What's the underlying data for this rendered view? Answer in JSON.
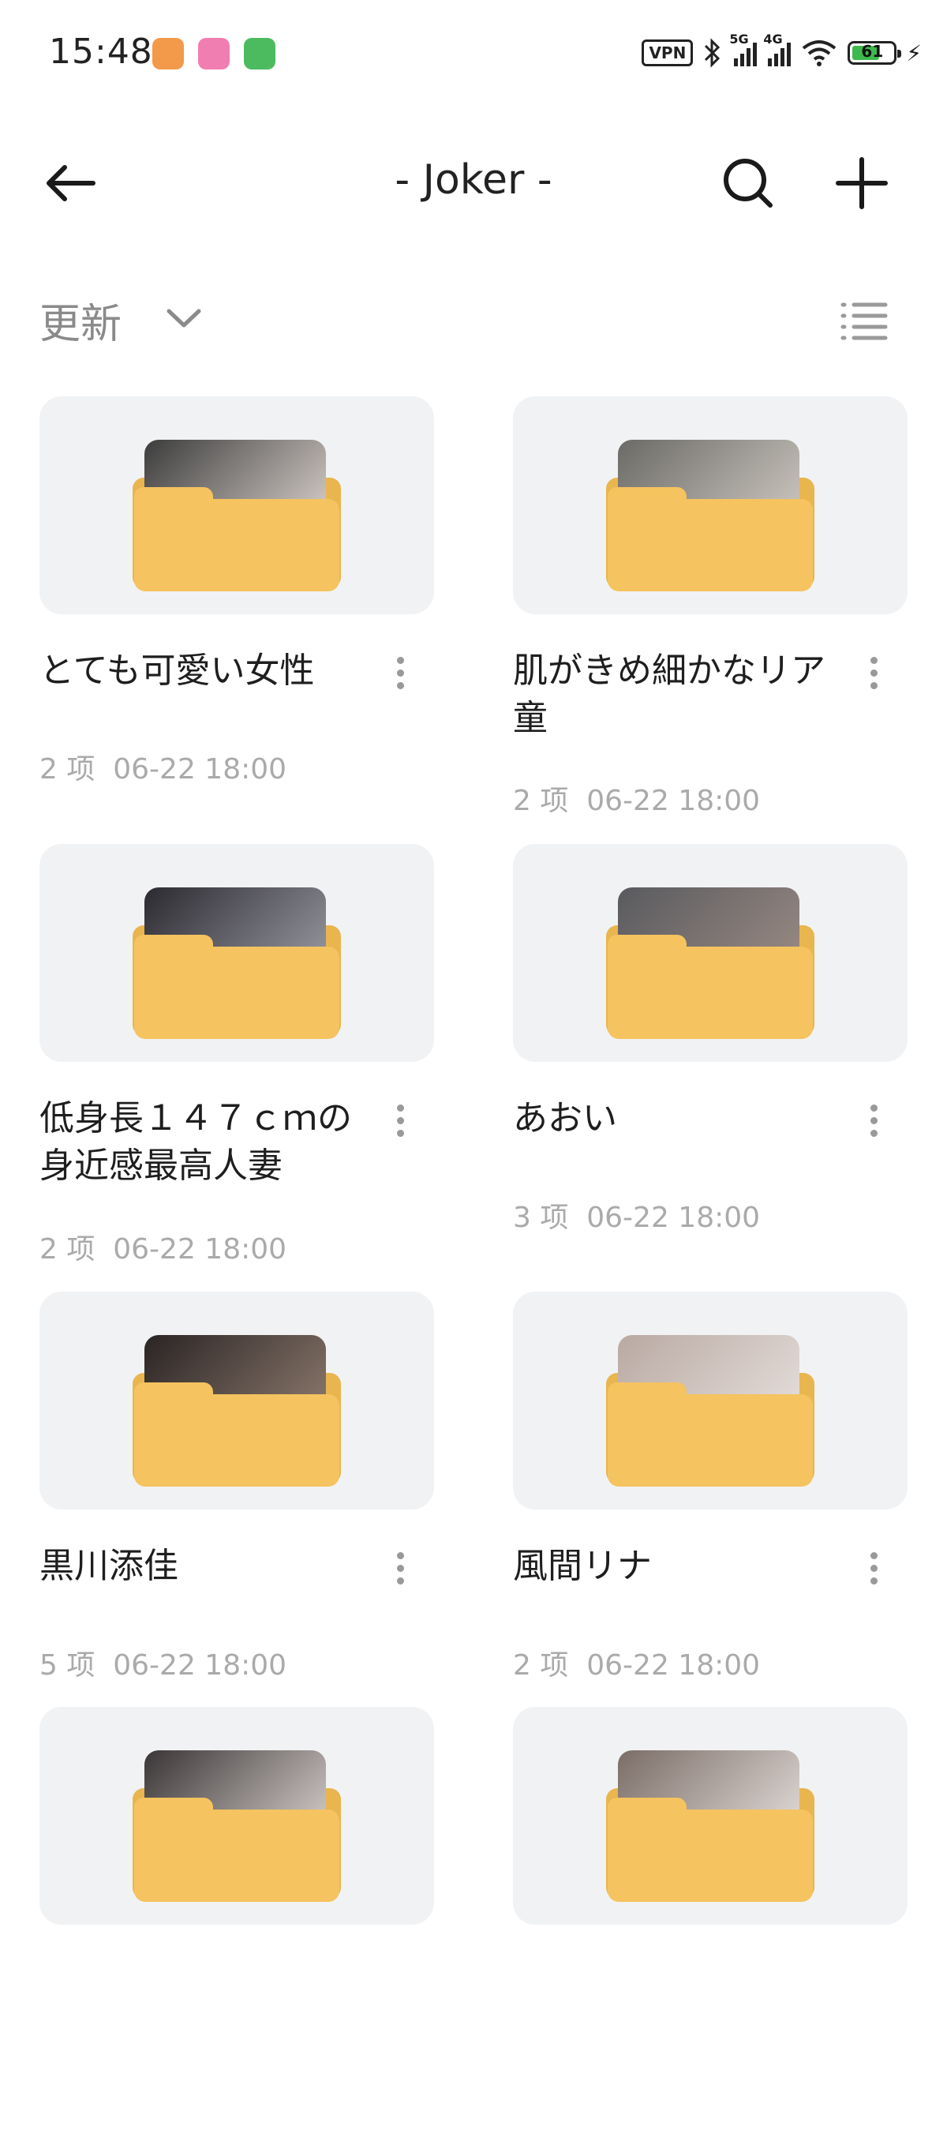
{
  "status_bar": {
    "time": "15:48",
    "vpn": "VPN",
    "network_5g": "5G",
    "network_4g": "4G",
    "battery": "61",
    "apps": [
      "orange-app-icon",
      "bilibili-app-icon",
      "green-bolt-app-icon"
    ]
  },
  "header": {
    "title": "- Joker -",
    "back_icon": "arrow-left-icon",
    "search_icon": "search-icon",
    "add_icon": "plus-icon"
  },
  "sort": {
    "label": "更新",
    "view_icon": "list-view-icon"
  },
  "folders": [
    {
      "name": "とても可愛い女性",
      "count": "2 项",
      "date": "06-22 18:00",
      "tint": [
        "#3c3c3c",
        "#d9d1cc"
      ]
    },
    {
      "name": "肌がきめ細かなリア童",
      "count": "2 项",
      "date": "06-22 18:00",
      "tint": [
        "#6b6a66",
        "#cfc9c2"
      ]
    },
    {
      "name": "低身長１４７ｃｍの身近感最高人妻",
      "count": "2 项",
      "date": "06-22 18:00",
      "tint": [
        "#2b2a30",
        "#9a9aa4"
      ]
    },
    {
      "name": "あおい",
      "count": "3 项",
      "date": "06-22 18:00",
      "tint": [
        "#595a5e",
        "#9b8b84"
      ]
    },
    {
      "name": "黒川添佳",
      "count": "5 项",
      "date": "06-22 18:00",
      "tint": [
        "#2a2424",
        "#8d7a6e"
      ]
    },
    {
      "name": "風間リナ",
      "count": "2 项",
      "date": "06-22 18:00",
      "tint": [
        "#b9a9a2",
        "#e6dfdc"
      ]
    },
    {
      "name": "",
      "count": "",
      "date": "",
      "tint": [
        "#3a3536",
        "#d6cfcc"
      ]
    },
    {
      "name": "",
      "count": "",
      "date": "",
      "tint": [
        "#7a6d66",
        "#e4ddda"
      ]
    }
  ]
}
